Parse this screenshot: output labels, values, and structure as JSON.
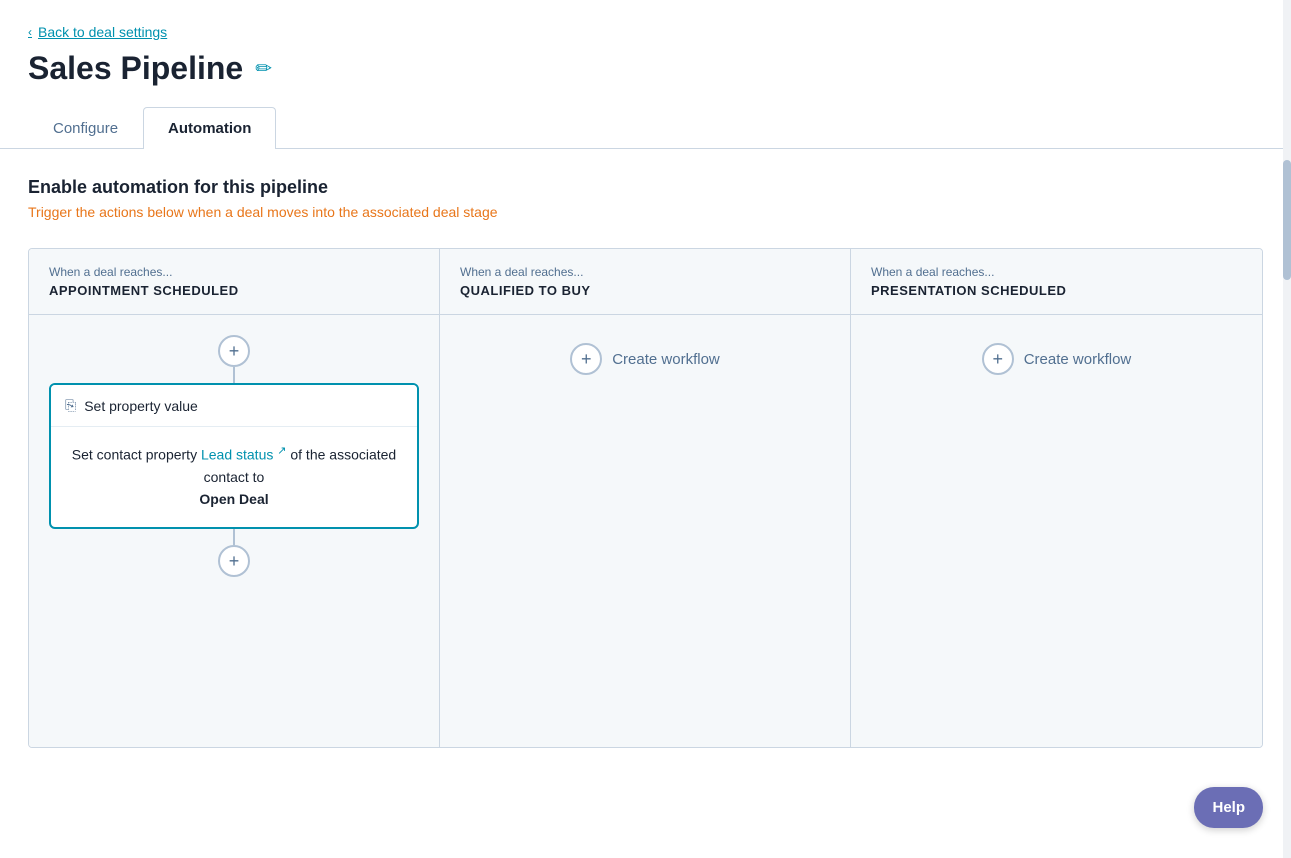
{
  "back_link": {
    "label": "Back to deal settings",
    "chevron": "‹"
  },
  "page_title": "Sales Pipeline",
  "edit_icon": "✏",
  "tabs": [
    {
      "id": "configure",
      "label": "Configure",
      "active": false
    },
    {
      "id": "automation",
      "label": "Automation",
      "active": true
    }
  ],
  "automation_section": {
    "title": "Enable automation for this pipeline",
    "subtitle": "Trigger the actions below when a deal moves into the associated deal stage"
  },
  "pipeline_columns": [
    {
      "id": "appointment-scheduled",
      "header_label": "When a deal reaches...",
      "header_title": "APPOINTMENT SCHEDULED",
      "has_card": true,
      "card": {
        "title": "Set property value",
        "body_prefix": "Set contact property",
        "link_text": "Lead status",
        "body_middle": "of the associated contact to",
        "body_value": "Open Deal"
      }
    },
    {
      "id": "qualified-to-buy",
      "header_label": "When a deal reaches...",
      "header_title": "QUALIFIED TO BUY",
      "has_card": false,
      "create_workflow_label": "Create workflow"
    },
    {
      "id": "presentation-scheduled",
      "header_label": "When a deal reaches...",
      "header_title": "PRESENTATION SCHEDULED",
      "has_card": false,
      "create_workflow_label": "Create workflow"
    }
  ],
  "help_button": {
    "label": "Help"
  }
}
